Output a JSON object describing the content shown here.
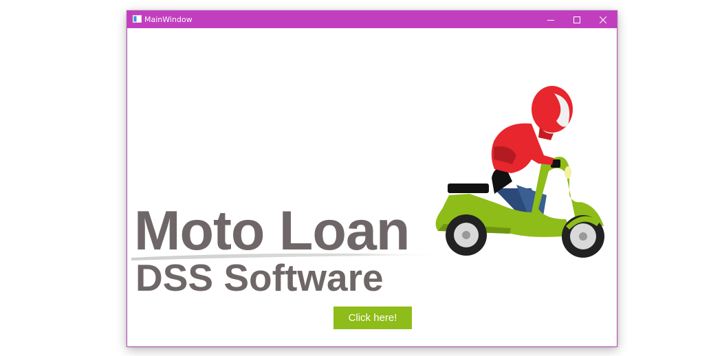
{
  "window": {
    "title": "MainWindow",
    "controls": {
      "minimize": "minimize-icon",
      "maximize": "maximize-icon",
      "close": "close-icon"
    }
  },
  "logo": {
    "line1": "Moto Loan",
    "line2": "DSS Software"
  },
  "cta_button": {
    "label": "Click here!"
  },
  "colors": {
    "titlebar": "#c13fbf",
    "logo_text": "#6f6767",
    "button": "#8ebc18",
    "scooter_body": "#8ebc18",
    "helmet": "#e8262d"
  }
}
